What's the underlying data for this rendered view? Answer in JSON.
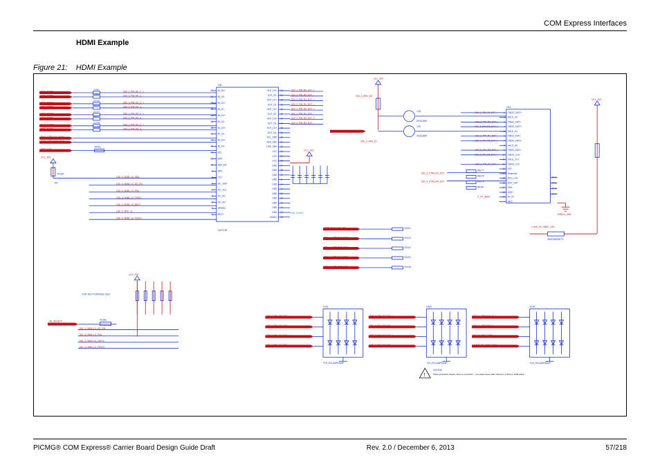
{
  "header": {
    "right": "COM Express Interfaces"
  },
  "heading": "HDMI Example",
  "figure": {
    "number": "Figure 21:",
    "title": "HDMI Example"
  },
  "footer": {
    "left": "PICMG® COM Express® Carrier Board Design Guide Draft",
    "center": "Rev. 2.0 / December 6, 2013",
    "right": "57/218"
  },
  "schematic": {
    "rails": [
      "VCC_3V3",
      "VCC_5V0",
      "V_5V0_S0_HDMI_CON"
    ],
    "central_ic": {
      "ref": "U36",
      "part_hint": "CHF374E",
      "left_pins": [
        "IN_D0+",
        "IN_D0-",
        "IN_D1+",
        "IN_D1-",
        "IN_D2+",
        "IN_D2-",
        "IN_D3+",
        "IN_D3-",
        "IN_D4+",
        "IN_D4-",
        "SCL",
        "SDA",
        "SDA_EN",
        "HPD",
        "VCC",
        "I2C_SDA",
        "I2C_SCL",
        "OV_DC",
        "OE_EN",
        "HPDEN",
        "REXT"
      ],
      "left_pin_nums": [
        "37",
        "36",
        "39",
        "38",
        "42",
        "41",
        "45",
        "44",
        "47",
        "46",
        "49",
        "50",
        "48",
        "1",
        "2",
        "3",
        "4",
        "5",
        "6",
        "7",
        "9"
      ],
      "right_pins": [
        "OUT_D0+",
        "OUT_D0-",
        "OUT_D1+",
        "OUT_D1-",
        "OUT_D2+",
        "OUT_D2-",
        "OUT_D3+",
        "OUT_D3-",
        "OUT_D4+",
        "OUT_D4-",
        "SCL_SNK",
        "SDA_SNK",
        "HPD_SNK",
        "VCC",
        "VCC",
        "VCC",
        "GND",
        "GND",
        "GND",
        "GND",
        "GND",
        "GND",
        "GND",
        "GND",
        "GND",
        "GND",
        "GND",
        "GND11"
      ],
      "right_pin_nums": [
        "22",
        "21",
        "19",
        "18",
        "16",
        "15",
        "13",
        "12",
        "28",
        "29",
        "30",
        "31",
        "32",
        "33",
        "34",
        "26",
        "27",
        "35",
        "10",
        "11",
        "14",
        "17",
        "20",
        "23",
        "43",
        "40",
        "24",
        "25"
      ]
    },
    "left_nets_in": [
      "DDI3_PAIR0+",
      "DDI3_PAIR0-",
      "DDI3_PAIR1+",
      "DDI3_PAIR1-",
      "DDI3_PAIR2+",
      "DDI3_PAIR2-",
      "DDI3_PAIR3+",
      "DDI3_PAIR3-",
      "DDI3_CTRLCLK_AUX+",
      "DDI3_CTRLDATA_AUX-",
      "DDI3_HPD"
    ],
    "coupling_caps": [
      "C1061",
      "C1076",
      "C1077",
      "C1078",
      "C1075",
      "C1074"
    ],
    "int_nets": [
      "DDI_3_PIN_R0_C_+",
      "DDI_3_PIN_R0_C_-",
      "DDI_3_PIN_R1_C_+",
      "DDI_3_PIN_R1_C_-",
      "DDI_3_PIN_R2_C_+",
      "DDI_3_PIN_R2_C_-",
      "DDI_3_PIN_R3_C_+",
      "DDI_3_PIN_R3_C_-"
    ],
    "ext_nets": [
      "DDI_3_PIN_R0_EXT_+",
      "DDI_3_PIN_R0_EXT_-",
      "DDI_3_PIN_R1_EXT_+",
      "DDI_3_PIN_R1_EXT_-",
      "DDI_3_PIN_R2_EXT_+",
      "DDI_3_PIN_R2_EXT_-",
      "DDI_3_PIN_R3_EXT_+",
      "DDI_3_PIN_R3_EXT_-"
    ],
    "ls_nets": [
      "DDI_3_HDMI_LS_OE#",
      "DDI_3_HDMI_LS_I2C_EN",
      "DDI_3_HDMI_LS_PD#",
      "DDI_3_HDMI_LS_TEST1",
      "DDI_3_HDMI_LS_REXT",
      "DDI_3_HPD_LS",
      "DDI_3_HDMI_LS_TEST2"
    ],
    "hpd_nets": [
      "DDI_3_HPD_INT",
      "DDI_3_HPD_EXT#",
      "DDI_3_HPD_LS"
    ],
    "aux_nets": [
      "DDI3_DDC_AUX_SEL",
      "DDI_3_CTRLCLK_AUX_+",
      "DDI_3_CTRLDAT_AUX_-",
      "DDI_3_CTRLCLK_EXT",
      "DDI_3_CTRLDAT_EXT"
    ],
    "aux_resistors": [
      "R1321",
      "R1319",
      "R1320",
      "R1322",
      "R1318"
    ],
    "mosfets": [
      "U32",
      "U33"
    ],
    "mosfet_part": "BSS138W",
    "hdmi_conn": {
      "ref": "J116",
      "pins": [
        "TMDS_DAT2+",
        "SHLD_D2",
        "TMDS_DAT2-",
        "TMDS_DAT1+",
        "SHLD_D1",
        "TMDS_DAT1-",
        "TMDS_DAT0+",
        "SHLD_D0",
        "TMDS_DAT0-",
        "TMDS_CLK+",
        "SHLD_CLK",
        "TMDS_CLK-",
        "CEC",
        "Reserved",
        "DDC_CLK",
        "DDC_DAT",
        "SDA",
        "GND",
        "5V_IN",
        "HPD"
      ],
      "pin_nums": [
        "1",
        "2",
        "3",
        "4",
        "5",
        "6",
        "7",
        "8",
        "9",
        "10",
        "11",
        "12",
        "13",
        "14",
        "15",
        "16",
        "17",
        "18",
        "19"
      ],
      "mh_pins": [
        "MH1",
        "MH2",
        "MH3",
        "MH4"
      ]
    },
    "termination_res": [
      "R8177",
      "R8178",
      "R8179",
      "R8180"
    ],
    "tvs_arrays": [
      {
        "ref": "D161",
        "part": "TVS_RCLAMP0524P",
        "inputs": [
          "DDI_3_PIN_R0_EXT_+",
          "DDI_3_PIN_R0_EXT_-",
          "DDI_3_PIN_R1_EXT_+",
          "DDI_3_PIN_R1_EXT_-"
        ]
      },
      {
        "ref": "D160",
        "part": "TVS_RCLAMP0524P",
        "inputs": [
          "DDI_3_PIN_R2_EXT_+",
          "DDI_3_PIN_R2_EXT_-",
          "DDI_3_PIN_R3_EXT_+",
          "DDI_3_PIN_R3_EXT_-"
        ]
      },
      {
        "ref": "D159",
        "part": "TVS_RCLAMP0524P",
        "inputs": [
          "DDI_3_CTRLCLK_C",
          "DDI_3_CTRLDAT_C",
          "DDI_3_HPD_EXT#",
          "V_5V0_S0_HDMI_CON"
        ]
      }
    ],
    "test_note": "FOR TEST PURPOSE ONLY",
    "test_net": "OE_RESET#",
    "test_res": "R1382",
    "note_box": {
      "ref": "NOTE46",
      "text": "Place protection diodes close to connector – use wide traces with minimum 2 VIAs to GND plane"
    },
    "misc_refs": [
      "R1001",
      "R1316",
      "R1318",
      "STP19",
      "SHIELD_GND",
      "GND_FLASH",
      "V_TP_HDMI",
      "HDMI_CEC",
      "DDI_3_HDMI_SYNC_C"
    ]
  }
}
